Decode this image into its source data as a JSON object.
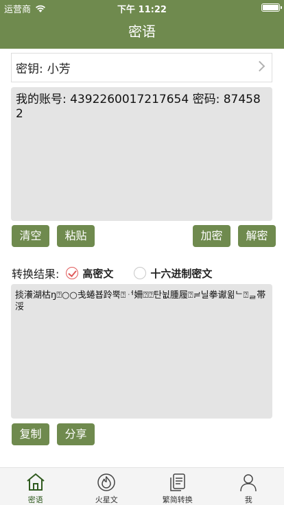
{
  "status_bar": {
    "carrier": "运营商",
    "time": "下午 11:22"
  },
  "nav": {
    "title": "密语"
  },
  "key_row": {
    "label": "密钥:",
    "value": "小芳"
  },
  "input": {
    "text": "我的账号: 4392260017217654 密码: 874582"
  },
  "buttons": {
    "clear": "清空",
    "paste": "粘贴",
    "encrypt": "加密",
    "decrypt": "解密",
    "copy": "复制",
    "share": "分享"
  },
  "result": {
    "label": "转换结果:",
    "option_high": "高密文",
    "option_hex": "十六进制密文",
    "selected": "option_high",
    "output": "掞瀁湖枯ŋ⍰○○戋蜷뵵跉뿍⍰ᆟ姍⍰⍰탄뉪腫履⍰≓닐拳谳윎ᄂ⍰ᆯ帯浽"
  },
  "tabs": [
    {
      "label": "密语",
      "icon": "home-icon",
      "active": true
    },
    {
      "label": "火星文",
      "icon": "fire-icon",
      "active": false
    },
    {
      "label": "繁简转换",
      "icon": "documents-icon",
      "active": false
    },
    {
      "label": "我",
      "icon": "person-icon",
      "active": false
    }
  ],
  "colors": {
    "accent": "#6f8a4e",
    "check": "#e05a5a"
  }
}
